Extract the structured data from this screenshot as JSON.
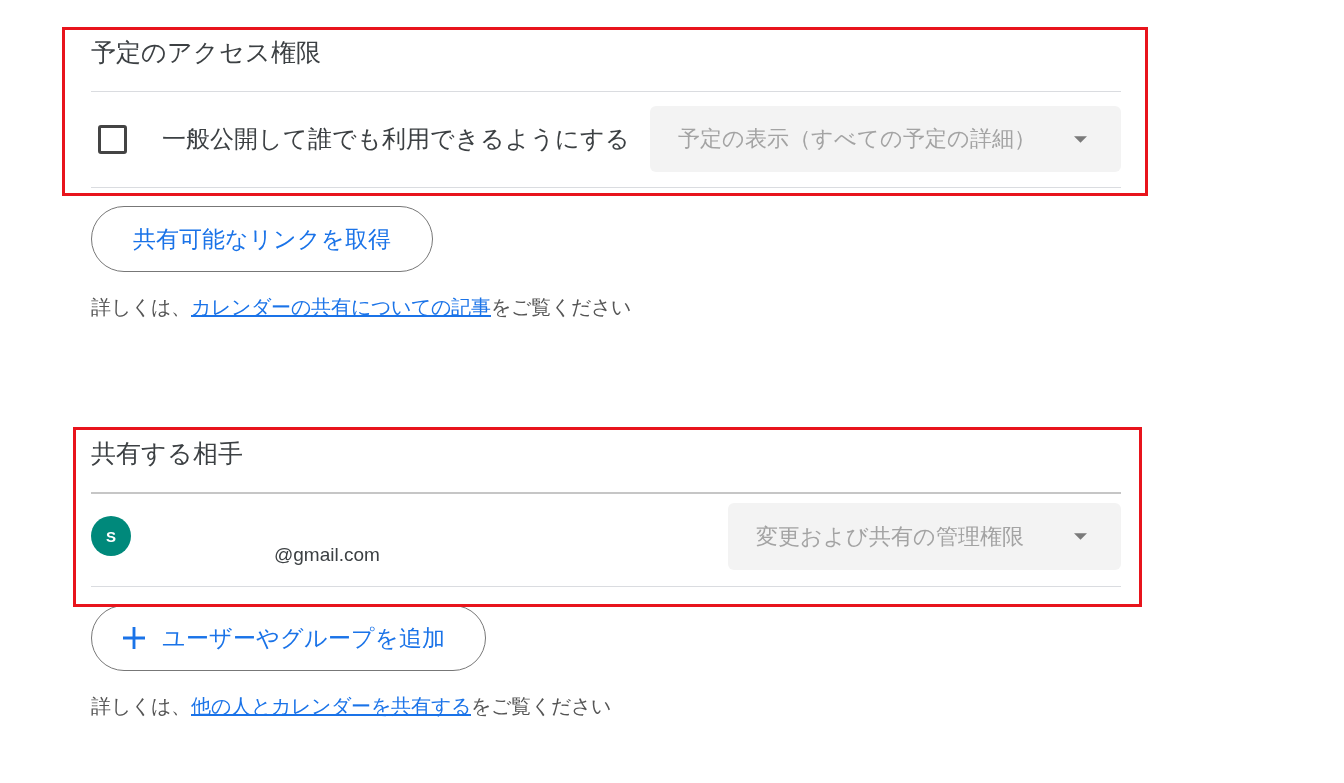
{
  "access": {
    "title": "予定のアクセス権限",
    "public_option": {
      "label": "一般公開して誰でも利用できるようにする",
      "checked": false
    },
    "visibility": {
      "value": "予定の表示（すべての予定の詳細）",
      "disabled": true
    },
    "link_button": "共有可能なリンクを取得",
    "help": {
      "before": "詳しくは、",
      "link": "カレンダーの共有についての記事",
      "after": "をご覧ください"
    }
  },
  "shared_with": {
    "title": "共有する相手",
    "people": [
      {
        "initial": "S",
        "email": "@gmail.com",
        "permission": "変更および共有の管理権限",
        "disabled": true
      }
    ],
    "add_button": "ユーザーやグループを追加",
    "help": {
      "before": "詳しくは、",
      "link": "他の人とカレンダーを共有する",
      "after": "をご覧ください"
    }
  }
}
